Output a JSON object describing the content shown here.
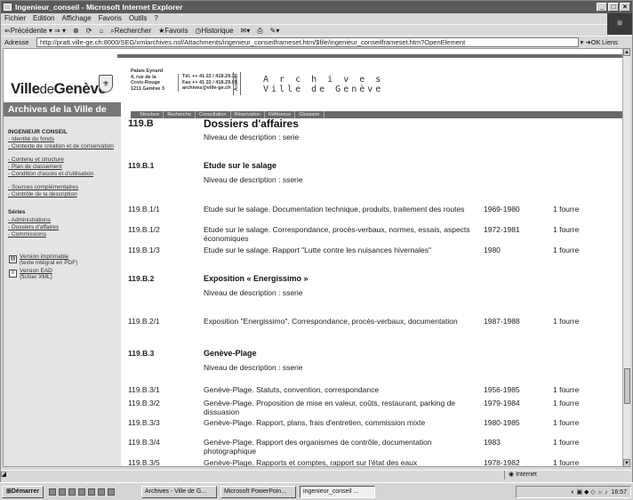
{
  "window": {
    "title": "Ingenieur_conseil - Microsoft Internet Explorer"
  },
  "menu": [
    "Fichier",
    "Edition",
    "Affichage",
    "Favoris",
    "Outils",
    "?"
  ],
  "toolbar": {
    "back": "Précédente",
    "search": "Rechercher",
    "favorites": "Favoris",
    "history": "Historique"
  },
  "address": {
    "label": "Adresse",
    "url": "http://pratt.ville-ge.ch:8000/SEG/xmlarchives.nsf/Attachments/ingenieur_conseilframeset.htm/$file/ingenieur_conseilframeset.htm?OpenElement",
    "go": "OK",
    "links": "Liens"
  },
  "site": {
    "logo_ville": "Ville",
    "logo_de": "de",
    "logo_geneve": "Genève",
    "address1": [
      "Palais Eynard",
      "4, rue de la",
      "Croix-Rouge",
      "1211 Genève 3"
    ],
    "address2": [
      "Tél. ++ 41 22 / 418.29.30",
      "Fax ++ 41 22 / 418.29.01",
      "archives@ville-ge.ch"
    ],
    "accueil": "Accueil",
    "archives_line1": "A r c h i v e s",
    "archives_line2": "Ville de Genève",
    "side_heading": "Archives de la Ville de",
    "nav": [
      "Structure",
      "Recherche",
      "Consultation",
      "Réservation",
      "Référence",
      "Glossaire"
    ]
  },
  "sidebar": {
    "title": "INGENIEUR CONSEIL",
    "links": [
      "- Identité du fonds",
      "- Contexte de création et de conservation",
      "- Contenu et structure",
      "- Plan de classement",
      "- Condition d'accès et d'utilisation",
      "- Sources complémentaires",
      "- Contrôle de la description"
    ],
    "series_label": "Séries",
    "series": [
      "- Administrations",
      "- Dossiers d'affaires",
      "- Commissions"
    ],
    "print_version": "Version imprimable",
    "print_note": "(texte intégral en PDF)",
    "ead_version": "Version EAD",
    "ead_note": "(fichier XML)"
  },
  "content": {
    "top_code": "119.B",
    "top_title": "Dossiers d'affaires",
    "top_niveau": "Niveau de description : serie",
    "groups": [
      {
        "code": "119.B.1",
        "title": "Etude sur le salage",
        "niveau": "Niveau de description : sserie",
        "rows": [
          {
            "code": "119.B.1/1",
            "desc": "Etude sur le salage. Documentation technique, produits, traitement des routes",
            "dates": "1969-1980",
            "qty": "1 fourre"
          },
          {
            "code": "119.B.1/2",
            "desc": "Etude sur le salage. Correspondance, procès-verbaux, normes, essais, aspects économiques",
            "dates": "1972-1981",
            "qty": "1 fourre"
          },
          {
            "code": "119.B.1/3",
            "desc": "Etude sur le salage. Rapport \"Lutte contre les nuisances hivernales\"",
            "dates": "1980",
            "qty": "1 fourre"
          }
        ]
      },
      {
        "code": "119.B.2",
        "title": "Exposition « Energissimo »",
        "niveau": "Niveau de description : sserie",
        "rows": [
          {
            "code": "119.B.2/1",
            "desc": "Exposition \"Energissimo\". Correspondance, procès-verbaux, documentation",
            "dates": "1987-1988",
            "qty": "1 fourre"
          }
        ]
      },
      {
        "code": "119.B.3",
        "title": "Genève-Plage",
        "niveau": "Niveau de description : sserie",
        "rows": [
          {
            "code": "119.B.3/1",
            "desc": "Genève-Plage. Statuts, convention, correspondance",
            "dates": "1956-1985",
            "qty": "1 fourre"
          },
          {
            "code": "119.B.3/2",
            "desc": "Genève-Plage. Proposition de mise en valeur, coûts, restaurant, parking de dissuasion",
            "dates": "1979-1984",
            "qty": "1 fourre"
          },
          {
            "code": "119.B.3/3",
            "desc": "Genève-Plage. Rapport, plans, frais d'entretien, commission mixte",
            "dates": "1980-1985",
            "qty": "1 fourre"
          },
          {
            "code": "119.B.3/4",
            "desc": "Genève-Plage. Rapport des organismes de contrôle, documentation photographique",
            "dates": "1983",
            "qty": "1 fourre"
          },
          {
            "code": "119.B.3/5",
            "desc": "Genève-Plage. Rapports et comptes, rapport sur l'état des eaux",
            "dates": "1978-1982",
            "qty": "1 fourre"
          }
        ]
      }
    ]
  },
  "statusbar": {
    "zone": "Internet"
  },
  "taskbar": {
    "start": "Démarrer",
    "tasks": [
      "Archives - Ville de G...",
      "Microsoft PowerPoin...",
      "ingenieur_conseil ..."
    ],
    "clock": "16:57"
  }
}
